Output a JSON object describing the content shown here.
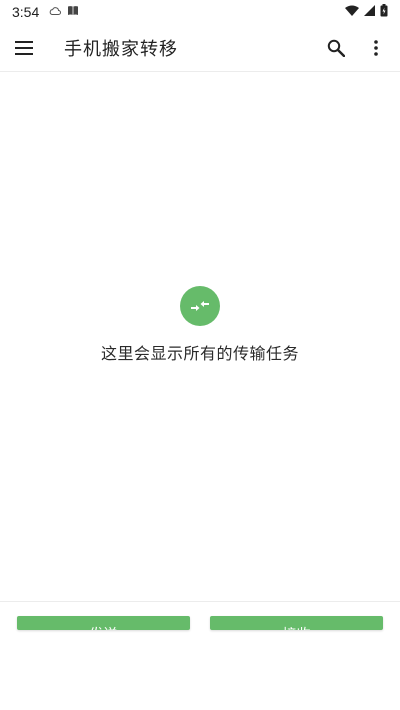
{
  "status_bar": {
    "time": "3:54"
  },
  "app_bar": {
    "title": "手机搬家转移"
  },
  "empty_state": {
    "message": "这里会显示所有的传输任务"
  },
  "buttons": {
    "send": "发送",
    "receive": "接收"
  },
  "colors": {
    "accent": "#66bb6a"
  }
}
